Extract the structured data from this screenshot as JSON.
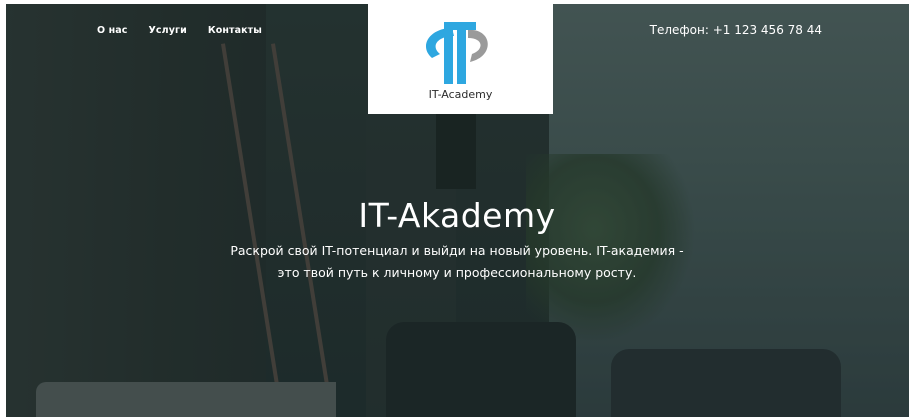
{
  "nav": {
    "items": [
      {
        "label": "О нас"
      },
      {
        "label": "Услуги"
      },
      {
        "label": "Контакты"
      }
    ]
  },
  "header": {
    "phone": "Телефон: +1 123 456 78 44"
  },
  "logo": {
    "text": "IT-Academy",
    "icon": "it-academy-logo-icon",
    "colors": {
      "accent": "#2ea7e0",
      "gray": "#9a9a9a"
    }
  },
  "hero": {
    "title": "IT-Akademy",
    "subtitle_line1": "Раскрой свой IT-потенциал и выйди на новый уровень. IT-академия -",
    "subtitle_line2": "это твой путь к личному и профессиональному росту."
  }
}
